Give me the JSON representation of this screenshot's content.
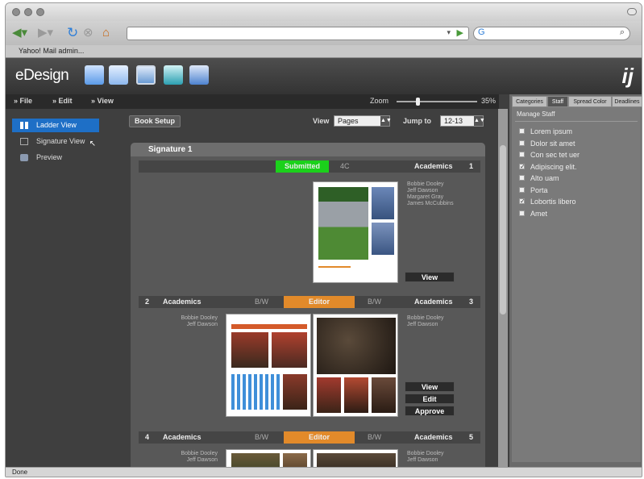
{
  "browser": {
    "bookmark_text": "Yahoo! Mail   admin..."
  },
  "app": {
    "logo": "eDesign",
    "brand": "ij",
    "menu": {
      "file": "» File",
      "edit": "» Edit",
      "view": "» View"
    },
    "zoom_label": "Zoom",
    "zoom_value": "35%",
    "zoom_level": 0.25
  },
  "left_nav": {
    "items": [
      {
        "label": "Ladder View",
        "icon": "grid-icon",
        "active": true
      },
      {
        "label": "Signature View",
        "icon": "signature-icon",
        "active": false
      },
      {
        "label": "Preview",
        "icon": "preview-icon",
        "active": false
      }
    ]
  },
  "content": {
    "book_setup": "Book Setup",
    "view_label": "View",
    "view_value": "Pages",
    "jump_label": "Jump to",
    "jump_value": "12-13"
  },
  "signature": {
    "title": "Signature 1",
    "spreads": [
      {
        "left_num": "",
        "left_section": "",
        "left_color": "",
        "status": "Submitted",
        "status_color": "#1bd11b",
        "right_color": "4C",
        "right_section": "Academics",
        "right_num": "1",
        "names": "Bobbie Dooley\nJeff Dawson\nMargaret Gray\nJames McCubbins",
        "actions": [
          "View"
        ]
      },
      {
        "left_num": "2",
        "left_section": "Academics",
        "left_color": "B/W",
        "status": "Editor",
        "status_color": "#e28a2a",
        "right_color": "B/W",
        "right_section": "Academics",
        "right_num": "3",
        "left_names": "Bobbie Dooley\nJeff Dawson",
        "names": "Bobbie Dooley\nJeff Dawson",
        "actions": [
          "View",
          "Edit",
          "Approve"
        ]
      },
      {
        "left_num": "4",
        "left_section": "Academics",
        "left_color": "B/W",
        "status": "Editor",
        "status_color": "#e28a2a",
        "right_color": "B/W",
        "right_section": "Academics",
        "right_num": "5",
        "left_names": "Bobbie Dooley\nJeff Dawson",
        "names": "Bobbie Dooley\nJeff Dawson",
        "actions": []
      }
    ]
  },
  "right_panel": {
    "tabs": [
      "Categories",
      "Staff",
      "Spread Color",
      "Deadlines"
    ],
    "active_tab": "Staff",
    "manage": "Manage Staff",
    "staff": [
      {
        "name": "Lorem ipsum",
        "checked": false
      },
      {
        "name": "Dolor sit amet",
        "checked": false
      },
      {
        "name": "Con sec tet uer",
        "checked": false
      },
      {
        "name": "Adipiscing elit.",
        "checked": true
      },
      {
        "name": "Alto uam",
        "checked": false
      },
      {
        "name": "Porta",
        "checked": false
      },
      {
        "name": "Lobortis libero",
        "checked": true
      },
      {
        "name": "Amet",
        "checked": false
      }
    ]
  },
  "status_bar": "Done"
}
